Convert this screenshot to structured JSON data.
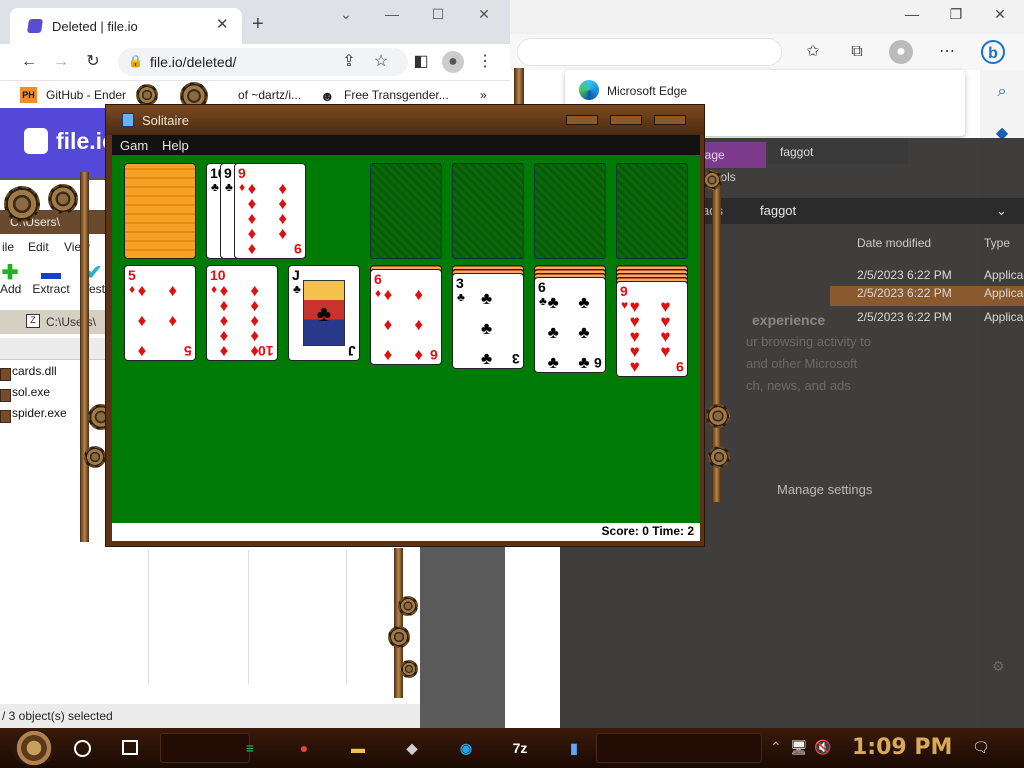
{
  "chrome": {
    "tab_title": "Deleted | file.io",
    "url": "file.io/deleted/",
    "bookmarks": [
      {
        "label": "GitHub - Ender"
      },
      {
        "label": "of ~dartz/i..."
      },
      {
        "label": "Free Transgender..."
      }
    ],
    "brand": "file.io",
    "ph_badge": "PH"
  },
  "edge": {
    "ntp_label": "Microsoft Edge"
  },
  "dark_explorer": {
    "tab_manage": "nage",
    "tab_folder": "faggot",
    "tools_label": "n Tools",
    "path_prefix": "ads",
    "path_folder": "faggot",
    "col_date": "Date modified",
    "col_type": "Type",
    "rows": [
      {
        "date": "2/5/2023 6:22 PM",
        "type": "Applica"
      },
      {
        "date": "2/5/2023 6:22 PM",
        "type": "Applica"
      },
      {
        "date": "2/5/2023 6:22 PM",
        "type": "Applica"
      }
    ],
    "experience": "experience",
    "blur_lines": [
      "ur browsing activity to",
      "and other Microsoft",
      "ch, news, and ads"
    ],
    "manage_settings": "Manage settings"
  },
  "zip": {
    "title": "C:\\Users\\",
    "menu": [
      "ile",
      "Edit",
      "View"
    ],
    "toolbar": [
      {
        "label": "Add"
      },
      {
        "label": "Extract"
      },
      {
        "label": "Test"
      }
    ],
    "address": "C:\\Users\\",
    "files": [
      "cards.dll",
      "sol.exe",
      "spider.exe"
    ],
    "status": "/ 3 object(s) selected"
  },
  "solitaire": {
    "title": "Solitaire",
    "menu": [
      "Gam",
      "Help"
    ],
    "status": "Score: 0 Time: 2",
    "waste": [
      {
        "rank": "10",
        "suit": "♣",
        "color": "blk"
      },
      {
        "rank": "9",
        "suit": "♣",
        "color": "blk"
      },
      {
        "rank": "9",
        "suit": "♦",
        "color": "red"
      }
    ],
    "tableau": [
      {
        "rank": "5",
        "suit": "♦",
        "color": "red"
      },
      {
        "rank": "10",
        "suit": "♦",
        "color": "red"
      },
      {
        "rank": "J",
        "suit": "♣",
        "color": "blk"
      },
      {
        "rank": "6",
        "suit": "♦",
        "color": "red"
      },
      {
        "rank": "3",
        "suit": "♣",
        "color": "blk"
      },
      {
        "rank": "6",
        "suit": "♣",
        "color": "blk"
      },
      {
        "rank": "9",
        "suit": "♥",
        "color": "red"
      }
    ],
    "hidden_counts": [
      0,
      0,
      0,
      1,
      2,
      3,
      4
    ]
  },
  "taskbar": {
    "clock": "1:09 PM",
    "apps": [
      {
        "name": "chat",
        "glyph": "≡",
        "color": "#2ebd59"
      },
      {
        "name": "chrome",
        "glyph": "●",
        "color": "#e8453c"
      },
      {
        "name": "explorer",
        "glyph": "▬",
        "color": "#f2c14e"
      },
      {
        "name": "paint",
        "glyph": "◆",
        "color": "#d0d0d0"
      },
      {
        "name": "edge",
        "glyph": "◉",
        "color": "#2aa0e6"
      },
      {
        "name": "7zip",
        "glyph": "7z",
        "color": "#ffffff"
      },
      {
        "name": "solitaire",
        "glyph": "▮",
        "color": "#5aa8ff"
      }
    ]
  }
}
